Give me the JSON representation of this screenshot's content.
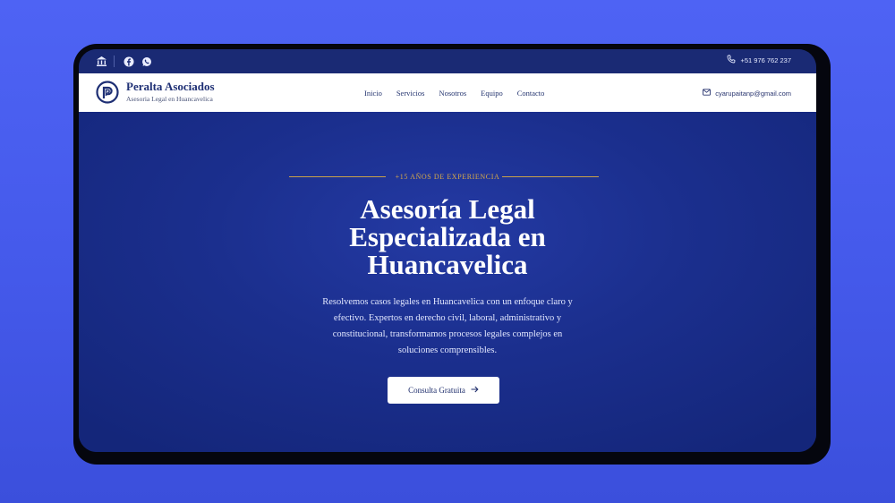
{
  "topbar": {
    "icons": [
      "landmark-icon",
      "facebook-icon",
      "whatsapp-icon"
    ],
    "phone": "+51 976 762 237"
  },
  "navbar": {
    "brand_name": "Peralta Asociados",
    "brand_tagline": "Asesoria Legal en Huancavelica",
    "links": [
      "Inicio",
      "Servicios",
      "Nosotros",
      "Equipo",
      "Contacto"
    ],
    "email": "cyarupaitanp@gmail.com"
  },
  "hero": {
    "eyebrow": "+15 AÑOS DE EXPERIENCIA",
    "headline_line1": "Asesoría Legal",
    "headline_line2": "Especializada en",
    "headline_line3": "Huancavelica",
    "lead_line1": "Resolvemos casos legales en Huancavelica con un enfoque claro y",
    "lead_line2": "efectivo. Expertos en derecho civil, laboral, administrativo y",
    "lead_line3": "constitucional, transformamos procesos legales complejos en",
    "lead_line4": "soluciones comprensibles.",
    "cta_label": "Consulta Gratuita"
  },
  "colors": {
    "background": "#4e63f4",
    "topbar": "#1a2a74",
    "hero": "#1b2f8e",
    "accent_gold": "#d8aa4a",
    "brand_navy": "#1e2f74"
  }
}
